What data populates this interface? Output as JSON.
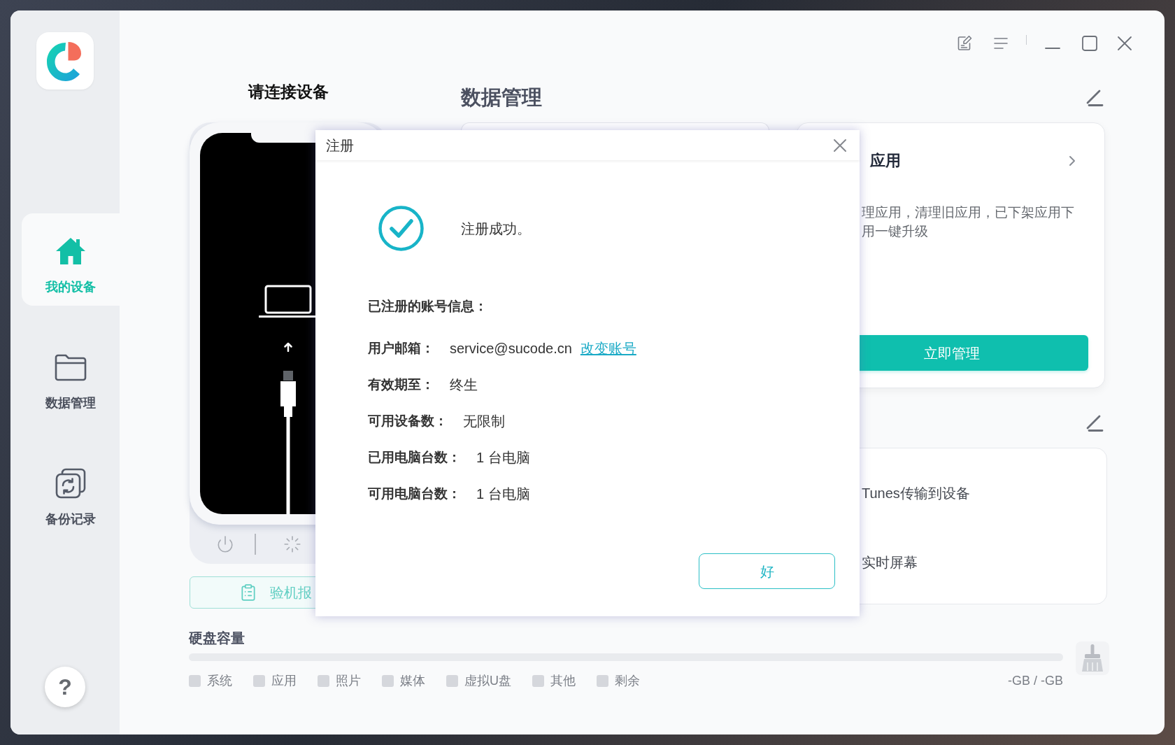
{
  "sidebar": {
    "items": [
      {
        "kind": "device",
        "label": "我的设备",
        "selected": true
      },
      {
        "kind": "data",
        "label": "数据管理",
        "selected": false
      },
      {
        "kind": "backup",
        "label": "备份记录",
        "selected": false
      }
    ],
    "help_label": "?"
  },
  "device_panel": {
    "title": "请连接设备",
    "report_button": "验机报"
  },
  "data_management": {
    "title": "数据管理",
    "app_card": {
      "title": "应用",
      "description": [
        "理应用，清理旧应用，已下架应用下",
        "用一键升级"
      ],
      "button": "立即管理"
    },
    "features": [
      "Tunes传输到设备",
      "实时屏幕"
    ]
  },
  "disk": {
    "title": "硬盘容量",
    "legend": [
      "系统",
      "应用",
      "照片",
      "媒体",
      "虚拟U盘",
      "其他",
      "剩余"
    ],
    "usage": "-GB / -GB"
  },
  "dialog": {
    "title": "注册",
    "message": "注册成功。",
    "info_title": "已注册的账号信息：",
    "rows": [
      {
        "label": "用户邮箱：",
        "value": "service@sucode.cn",
        "link": "改变账号"
      },
      {
        "label": "有效期至：",
        "value": "终生"
      },
      {
        "label": "可用设备数：",
        "value": "无限制"
      },
      {
        "label": "已用电脑台数：",
        "value": "1 台电脑"
      },
      {
        "label": "可用电脑台数：",
        "value": "1 台电脑"
      }
    ],
    "ok_button": "好"
  }
}
